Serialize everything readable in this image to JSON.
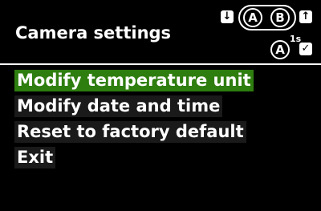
{
  "header": {
    "title": "Camera settings",
    "controls": {
      "down_arrow": "↓",
      "up_arrow": "↑",
      "button_a": "A",
      "button_b": "B",
      "hold_button": "A",
      "hold_duration": "1s",
      "confirm": "✓"
    }
  },
  "menu": {
    "items": [
      {
        "label": "Modify temperature unit",
        "selected": true
      },
      {
        "label": "Modify date and time",
        "selected": false
      },
      {
        "label": "Reset to factory default",
        "selected": false
      },
      {
        "label": "Exit",
        "selected": false
      }
    ]
  },
  "colors": {
    "background": "#000000",
    "highlight": "#2e7d0f",
    "item_background": "#1a1a1a",
    "text": "#ffffff"
  }
}
